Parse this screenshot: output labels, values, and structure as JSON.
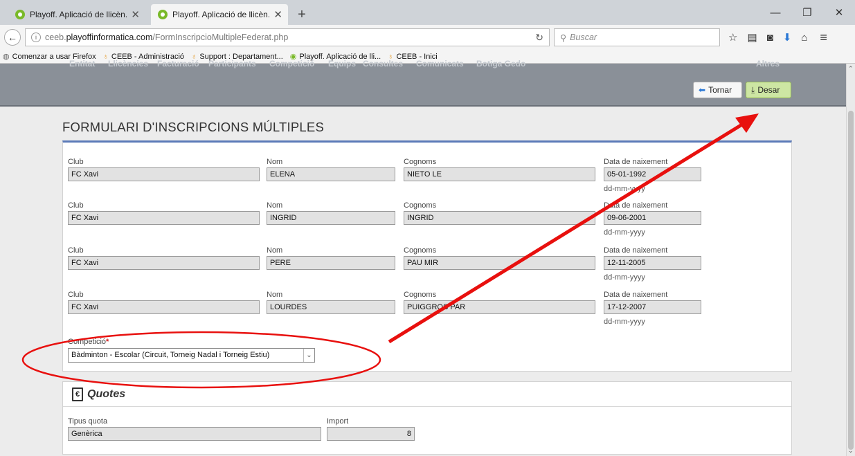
{
  "browser": {
    "tabs": [
      {
        "title": "Playoff. Aplicació de llicèn..."
      },
      {
        "title": "Playoff. Aplicació de llicèn..."
      }
    ],
    "url_prefix": "ceeb.",
    "url_domain": "playoffinformatica.com",
    "url_path": "/FormInscripcioMultipleFederat.php",
    "search_placeholder": "Buscar",
    "bookmarks": [
      {
        "label": "Comenzar a usar Firefox"
      },
      {
        "label": "CEEB - Administració"
      },
      {
        "label": "Support : Departament..."
      },
      {
        "label": "Playoff. Aplicació de lli..."
      },
      {
        "label": "CEEB - Inici"
      }
    ]
  },
  "header": {
    "menu": [
      "Entitat",
      "Llicències",
      "Facturació",
      "Participants",
      "Competició",
      "Equips",
      "Consultes",
      "Comunicats",
      "Botiga Gedo",
      "Altres"
    ],
    "tornar_label": "Tornar",
    "desar_label": "Desar"
  },
  "form": {
    "title": "FORMULARI D'INSCRIPCIONS MÚLTIPLES",
    "labels": {
      "club": "Club",
      "nom": "Nom",
      "cognoms": "Cognoms",
      "data": "Data de naixement",
      "hint": "dd-mm-yyyy"
    },
    "rows": [
      {
        "club": "FC Xavi",
        "nom": "ELENA",
        "cognoms": "NIETO LE",
        "data": "05-01-1992"
      },
      {
        "club": "FC Xavi",
        "nom": "INGRID",
        "cognoms": "INGRID",
        "data": "09-06-2001"
      },
      {
        "club": "FC Xavi",
        "nom": "PERE",
        "cognoms": "PAU MIR",
        "data": "12-11-2005"
      },
      {
        "club": "FC Xavi",
        "nom": "LOURDES",
        "cognoms": "PUIGGROS PAR",
        "data": "17-12-2007"
      }
    ],
    "competicio_label": "Competició",
    "competicio_required": "*",
    "competicio_value": "Bàdminton - Escolar (Circuit, Torneig Nadal i Torneig Estiu)"
  },
  "quotes": {
    "title": "Quotes",
    "tipus_label": "Tipus quota",
    "tipus_value": "Genèrica",
    "import_label": "Import",
    "import_value": "8"
  },
  "annotation_color": "#e8100e"
}
